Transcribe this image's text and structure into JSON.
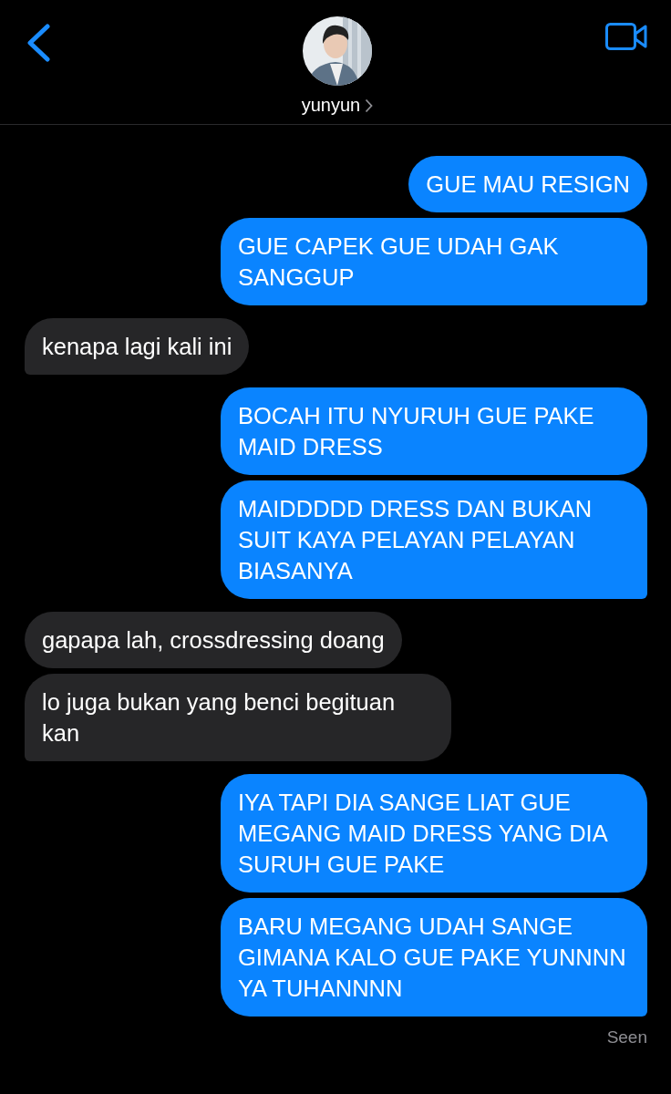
{
  "header": {
    "contact_name": "yunyun"
  },
  "messages": [
    {
      "kind": "sent",
      "text": "GUE MAU RESIGN",
      "tail": false
    },
    {
      "kind": "sent",
      "text": "GUE CAPEK GUE UDAH GAK SANGGUP",
      "tail": true
    },
    {
      "kind": "received",
      "text": "kenapa lagi kali ini",
      "tail": true
    },
    {
      "kind": "sent",
      "text": "BOCAH ITU NYURUH GUE PAKE MAID DRESS",
      "tail": false
    },
    {
      "kind": "sent",
      "text": "MAIDDDDD DRESS DAN BUKAN SUIT KAYA PELAYAN PELAYAN BIASANYA",
      "tail": true
    },
    {
      "kind": "received",
      "text": "gapapa lah, crossdressing doang",
      "tail": false
    },
    {
      "kind": "received",
      "text": "lo juga bukan yang benci begituan kan",
      "tail": true
    },
    {
      "kind": "sent",
      "text": "IYA TAPI DIA SANGE LIAT GUE MEGANG MAID DRESS YANG DIA SURUH GUE PAKE",
      "tail": false
    },
    {
      "kind": "sent",
      "text": "BARU MEGANG UDAH SANGE GIMANA KALO GUE PAKE YUNNNN YA TUHANNNN",
      "tail": true
    }
  ],
  "receipt": "Seen"
}
